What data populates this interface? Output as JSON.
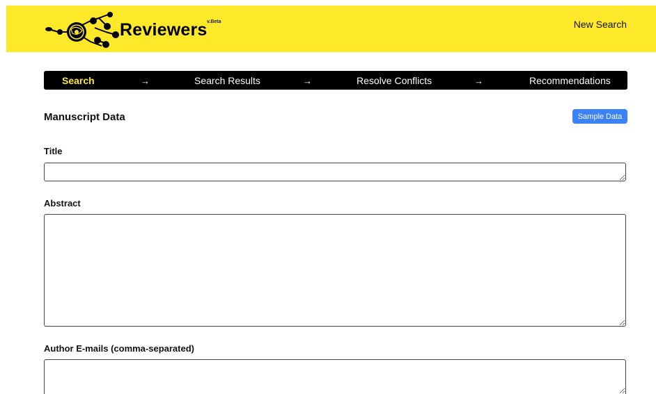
{
  "header": {
    "brand": "Reviewers",
    "version": "v.Beta",
    "new_search_label": "New Search",
    "background": "#fde92a"
  },
  "stepper": {
    "steps": [
      {
        "label": "Search",
        "active": true
      },
      {
        "label": "Search Results",
        "active": false
      },
      {
        "label": "Resolve Conflicts",
        "active": false
      },
      {
        "label": "Recommendations",
        "active": false
      }
    ],
    "arrow": "→",
    "active_color": "#fde92a"
  },
  "manuscript": {
    "section_title": "Manuscript Data",
    "sample_button_label": "Sample Data",
    "sample_button_color": "#3b82f6",
    "fields": {
      "title": {
        "label": "Title",
        "value": ""
      },
      "abstract": {
        "label": "Abstract",
        "value": ""
      },
      "author_emails": {
        "label": "Author E-mails (comma-separated)",
        "value": ""
      }
    }
  }
}
